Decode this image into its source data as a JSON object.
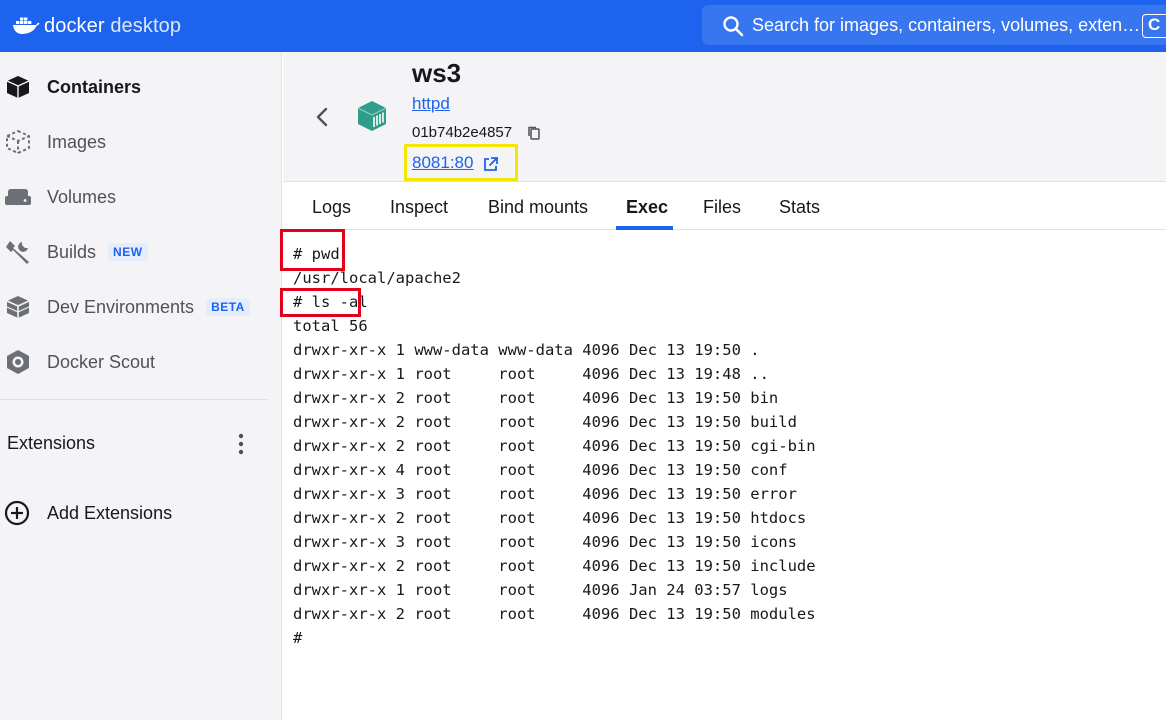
{
  "app": {
    "brand_part1": "docker",
    "brand_part2": "desktop",
    "search_placeholder": "Search for images, containers, volumes, exten…",
    "search_shortcut": "C"
  },
  "sidebar": {
    "items": [
      {
        "label": "Containers",
        "icon": "containers-icon",
        "active": true
      },
      {
        "label": "Images",
        "icon": "images-icon"
      },
      {
        "label": "Volumes",
        "icon": "volumes-icon"
      },
      {
        "label": "Builds",
        "icon": "builds-icon",
        "badge": "NEW"
      },
      {
        "label": "Dev Environments",
        "icon": "dev-environments-icon",
        "badge": "BETA"
      },
      {
        "label": "Docker Scout",
        "icon": "docker-scout-icon"
      }
    ],
    "extensions_title": "Extensions",
    "add_extensions": "Add Extensions"
  },
  "container": {
    "name": "ws3",
    "image": "httpd",
    "id": "01b74b2e4857",
    "port": "8081:80"
  },
  "tabs": [
    "Logs",
    "Inspect",
    "Bind mounts",
    "Exec",
    "Files",
    "Stats"
  ],
  "active_tab": "Exec",
  "terminal": [
    "# pwd",
    "/usr/local/apache2",
    "# ls -al",
    "total 56",
    "drwxr-xr-x 1 www-data www-data 4096 Dec 13 19:50 .",
    "drwxr-xr-x 1 root     root     4096 Dec 13 19:48 ..",
    "drwxr-xr-x 2 root     root     4096 Dec 13 19:50 bin",
    "drwxr-xr-x 2 root     root     4096 Dec 13 19:50 build",
    "drwxr-xr-x 2 root     root     4096 Dec 13 19:50 cgi-bin",
    "drwxr-xr-x 4 root     root     4096 Dec 13 19:50 conf",
    "drwxr-xr-x 3 root     root     4096 Dec 13 19:50 error",
    "drwxr-xr-x 2 root     root     4096 Dec 13 19:50 htdocs",
    "drwxr-xr-x 3 root     root     4096 Dec 13 19:50 icons",
    "drwxr-xr-x 2 root     root     4096 Dec 13 19:50 include",
    "drwxr-xr-x 1 root     root     4096 Jan 24 03:57 logs",
    "drwxr-xr-x 2 root     root     4096 Dec 13 19:50 modules",
    "#"
  ],
  "colors": {
    "accent": "#1d63ed",
    "highlight_red": "#e2001a",
    "highlight_yellow": "#f3e600",
    "container_icon": "#2e9e8a"
  }
}
